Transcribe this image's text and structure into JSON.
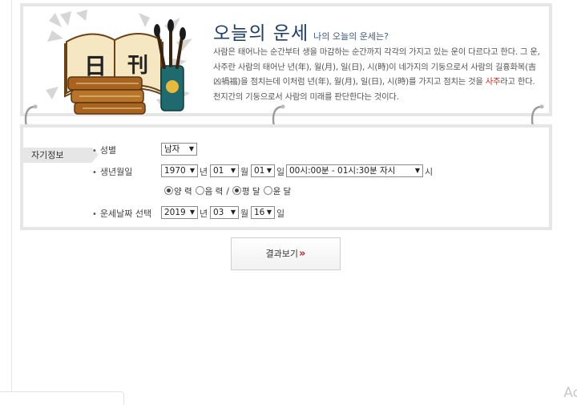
{
  "header": {
    "title": "오늘의 운세",
    "subtitle": "나의 오늘의 운세는?",
    "desc_part1": "사람은 태어나는 순간부터 생을 마감하는 순간까지 각각의 가지고 있는 운이 다르다고 한다. 그 운, 사주란 사람의 태어난 년(年), 월(月), 일(日), 시(時)이 네가지의 기둥으로서 사람의 길흉화복(吉凶禍福)을 점치는데 이처럼 년(年), 월(月), 일(日), 시(時)를 가지고 점치는 것을 ",
    "desc_highlight": "사주",
    "desc_part2": "라고 한다. 천지간의 기둥으로서 사람의 미래를 판단한다는 것이다.",
    "book_chars": [
      "日",
      "刊"
    ]
  },
  "form": {
    "section_label": "자기정보",
    "gender": {
      "label": "성별",
      "value": "남자"
    },
    "birth": {
      "label": "생년월일",
      "year": "1970",
      "year_unit": "년",
      "month": "01",
      "month_unit": "월",
      "day": "01",
      "day_unit": "일",
      "time": "00시:00분 - 01시:30분 자시",
      "time_unit": "시"
    },
    "calendar": {
      "solar": "양 력",
      "lunar": "음 력",
      "sep": "/",
      "normal": "평 달",
      "leap": "윤 달"
    },
    "fortune_date": {
      "label": "운세날짜 선택",
      "year": "2019",
      "year_unit": "년",
      "month": "03",
      "month_unit": "월",
      "day": "16",
      "day_unit": "일"
    }
  },
  "result_button": {
    "label": "결과보기",
    "arrow": "»"
  },
  "watermark": "Ac",
  "icons": {
    "dropdown": "dropdown-arrow-icon",
    "ring": "binder-ring-icon"
  },
  "colors": {
    "title": "#1f3d6b",
    "highlight": "#d8261b",
    "arrow": "#c0262c",
    "border": "#e6e6e6"
  }
}
